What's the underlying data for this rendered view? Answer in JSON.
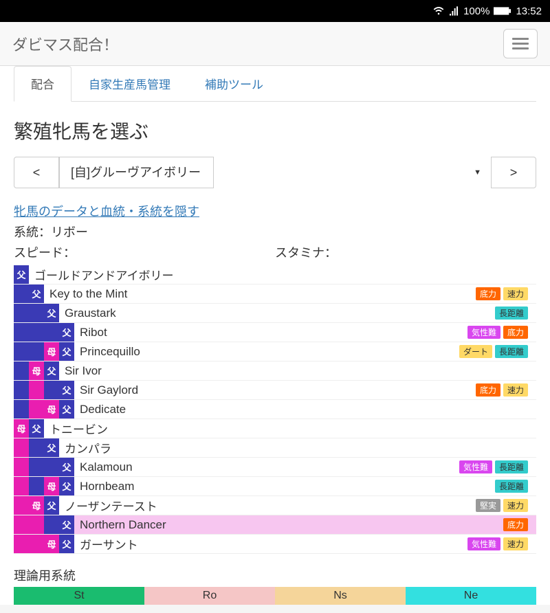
{
  "status": {
    "battery": "100%",
    "time": "13:52"
  },
  "header": {
    "title": "ダビマス配合！"
  },
  "tabs": [
    {
      "label": "配合",
      "active": true
    },
    {
      "label": "自家生産馬管理",
      "active": false
    },
    {
      "label": "補助ツール",
      "active": false
    }
  ],
  "section_title": "繁殖牝馬を選ぶ",
  "nav": {
    "prev": "<",
    "next": ">"
  },
  "mare_selected": "[自]グルーヴアイボリー",
  "toggle_link": "牝馬のデータと血統・系統を隠す",
  "lineage": "系統：リボー",
  "stats": {
    "speed_label": "スピード：",
    "stamina_label": "スタミナ："
  },
  "pedigree": [
    {
      "cells": [
        "f"
      ],
      "name": "ゴールドアンドアイボリー",
      "traits": []
    },
    {
      "cells": [
        "ef",
        "f"
      ],
      "name": "Key to the Mint",
      "traits": [
        "底力",
        "速力"
      ]
    },
    {
      "cells": [
        "ef",
        "ef",
        "f"
      ],
      "name": "Graustark",
      "traits": [
        "長距離"
      ]
    },
    {
      "cells": [
        "ef",
        "ef",
        "ef",
        "f"
      ],
      "name": "Ribot",
      "traits": [
        "気性難",
        "底力"
      ]
    },
    {
      "cells": [
        "ef",
        "ef",
        "m",
        "f"
      ],
      "name": "Princequillo",
      "traits": [
        "ダート",
        "長距離"
      ]
    },
    {
      "cells": [
        "ef",
        "m",
        "f"
      ],
      "name": "Sir Ivor",
      "traits": []
    },
    {
      "cells": [
        "ef",
        "em",
        "ef",
        "f"
      ],
      "name": "Sir Gaylord",
      "traits": [
        "底力",
        "速力"
      ]
    },
    {
      "cells": [
        "ef",
        "em",
        "m",
        "f"
      ],
      "name": "Dedicate",
      "traits": []
    },
    {
      "cells": [
        "m",
        "f"
      ],
      "name": "トニービン",
      "traits": []
    },
    {
      "cells": [
        "em",
        "ef",
        "f"
      ],
      "name": "カンパラ",
      "traits": []
    },
    {
      "cells": [
        "em",
        "ef",
        "ef",
        "f"
      ],
      "name": "Kalamoun",
      "traits": [
        "気性難",
        "長距離"
      ]
    },
    {
      "cells": [
        "em",
        "ef",
        "m",
        "f"
      ],
      "name": "Hornbeam",
      "traits": [
        "長距離"
      ]
    },
    {
      "cells": [
        "em",
        "m",
        "f"
      ],
      "name": "ノーザンテースト",
      "traits": [
        "堅実",
        "速力"
      ]
    },
    {
      "cells": [
        "em",
        "em",
        "ef",
        "f"
      ],
      "name": "Northern Dancer",
      "traits": [
        "底力"
      ],
      "highlight": true
    },
    {
      "cells": [
        "em",
        "em",
        "m",
        "f"
      ],
      "name": "ガーサント",
      "traits": [
        "気性難",
        "速力"
      ]
    }
  ],
  "theory": {
    "title": "理論用系統",
    "cells": [
      {
        "label": "St",
        "cls": "tc-st"
      },
      {
        "label": "Ro",
        "cls": "tc-ro"
      },
      {
        "label": "Ns",
        "cls": "tc-ns"
      },
      {
        "label": "Ne",
        "cls": "tc-ne"
      }
    ]
  }
}
